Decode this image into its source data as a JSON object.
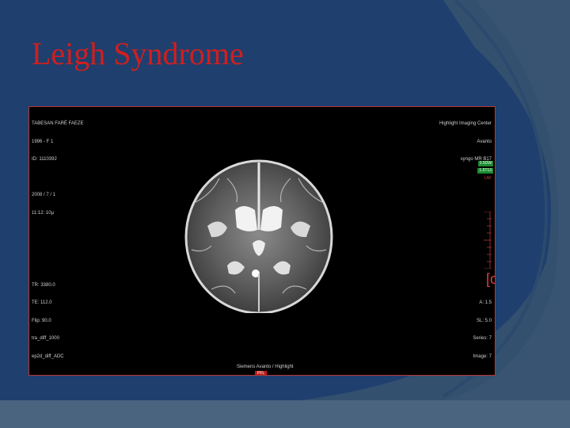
{
  "slide": {
    "title": "Leigh Syndrome",
    "colors": {
      "background": "#1f3f6e",
      "title": "#d01f1f",
      "frame": "#b23a3a"
    }
  },
  "mri": {
    "overlay_top_left": [
      "TABESAN FARÉ FAEZE",
      "1996 - F 1",
      "ID: 1110392",
      "",
      "2008 / 7 / 1",
      "11:12: 10µ"
    ],
    "overlay_top_right": [
      "Highlight Imaging Center",
      "Avanto",
      "syngo MR B17"
    ],
    "tags": {
      "green_1": "2.5DW",
      "green_2": "1.5T13",
      "red": "LAF"
    },
    "overlay_bottom_left": [
      "TR: 3380.0",
      "TE: 112.0",
      "Flip: 90.0",
      "tra_diff_1000",
      "ep2d_diff_ADC"
    ],
    "overlay_bottom_right": [
      "A: 1.5",
      "SL: 5.0",
      "Series: 7",
      "Image: 7"
    ],
    "overlay_bottom_center": "Siemens Avanto / Highlight",
    "orientation_bottom": "PFL",
    "bracket": "[ο"
  }
}
